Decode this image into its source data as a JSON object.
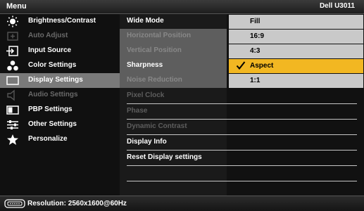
{
  "header": {
    "title": "Menu",
    "model": "Dell U3011"
  },
  "sidebar": {
    "items": [
      {
        "label": "Brightness/Contrast",
        "icon": "brightness-icon",
        "state": "enabled"
      },
      {
        "label": "Auto Adjust",
        "icon": "auto-adjust-icon",
        "state": "disabled"
      },
      {
        "label": "Input Source",
        "icon": "input-source-icon",
        "state": "enabled"
      },
      {
        "label": "Color Settings",
        "icon": "color-settings-icon",
        "state": "enabled"
      },
      {
        "label": "Display Settings",
        "icon": "display-settings-icon",
        "state": "selected"
      },
      {
        "label": "Audio Settings",
        "icon": "audio-icon",
        "state": "disabled"
      },
      {
        "label": "PBP Settings",
        "icon": "pbp-icon",
        "state": "enabled"
      },
      {
        "label": "Other Settings",
        "icon": "other-settings-icon",
        "state": "enabled"
      },
      {
        "label": "Personalize",
        "icon": "star-icon",
        "state": "enabled"
      }
    ]
  },
  "submenu": {
    "items": [
      {
        "label": "Wide Mode",
        "state": "enabled"
      },
      {
        "label": "Horizontal Position",
        "state": "disabled"
      },
      {
        "label": "Vertical Position",
        "state": "disabled"
      },
      {
        "label": "Sharpness",
        "state": "enabled"
      },
      {
        "label": "Noise Reduction",
        "state": "disabled"
      },
      {
        "label": "Pixel Clock",
        "state": "disabled"
      },
      {
        "label": "Phase",
        "state": "disabled"
      },
      {
        "label": "Dynamic Contrast",
        "state": "disabled"
      },
      {
        "label": "Display Info",
        "state": "enabled"
      },
      {
        "label": "Reset Display settings",
        "state": "enabled"
      }
    ]
  },
  "wide_mode_options": {
    "items": [
      {
        "label": "Fill",
        "selected": false
      },
      {
        "label": "16:9",
        "selected": false
      },
      {
        "label": "4:3",
        "selected": false
      },
      {
        "label": "Aspect",
        "selected": true
      },
      {
        "label": "1:1",
        "selected": false
      }
    ]
  },
  "footer": {
    "resolution": "Resolution: 2560x1600@60Hz",
    "icon": "monitor-connector-icon"
  },
  "colors": {
    "selected_option": "#f2b722",
    "selected_menu": "#7a7a7a",
    "option_bg": "#c9c9c9"
  }
}
